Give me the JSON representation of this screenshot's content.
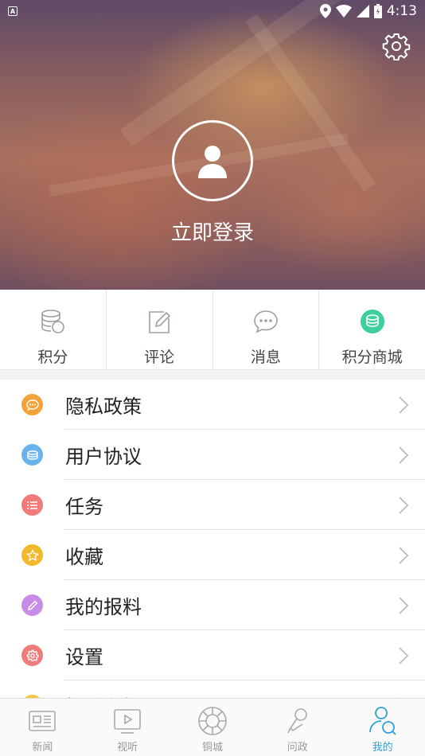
{
  "status_bar": {
    "time": "4:13"
  },
  "header": {
    "login_label": "立即登录"
  },
  "quick_actions": [
    {
      "label": "积分",
      "icon": "coins-stack-icon"
    },
    {
      "label": "评论",
      "icon": "edit-icon"
    },
    {
      "label": "消息",
      "icon": "chat-bubble-icon"
    },
    {
      "label": "积分商城",
      "icon": "points-mall-icon"
    }
  ],
  "menu": [
    {
      "label": "隐私政策",
      "icon": "privacy-icon",
      "color": "#f3a33a"
    },
    {
      "label": "用户协议",
      "icon": "agreement-icon",
      "color": "#6ab4ee"
    },
    {
      "label": "任务",
      "icon": "task-list-icon",
      "color": "#f07b7b"
    },
    {
      "label": "收藏",
      "icon": "star-icon",
      "color": "#f2b92c"
    },
    {
      "label": "我的报料",
      "icon": "pencil-icon",
      "color": "#c88ce8"
    },
    {
      "label": "设置",
      "icon": "gear-icon",
      "color": "#f07b7b"
    },
    {
      "label": "投诉举报",
      "icon": "report-icon",
      "color": "#f5c842"
    }
  ],
  "tabs": [
    {
      "label": "新闻",
      "icon": "newspaper-icon"
    },
    {
      "label": "视听",
      "icon": "video-icon"
    },
    {
      "label": "铜城",
      "icon": "city-emblem-icon"
    },
    {
      "label": "问政",
      "icon": "microphone-icon"
    },
    {
      "label": "我的",
      "icon": "profile-icon",
      "active": true
    }
  ],
  "colors": {
    "accent": "#2aa0dc",
    "mall_green": "#3ecf9d"
  }
}
